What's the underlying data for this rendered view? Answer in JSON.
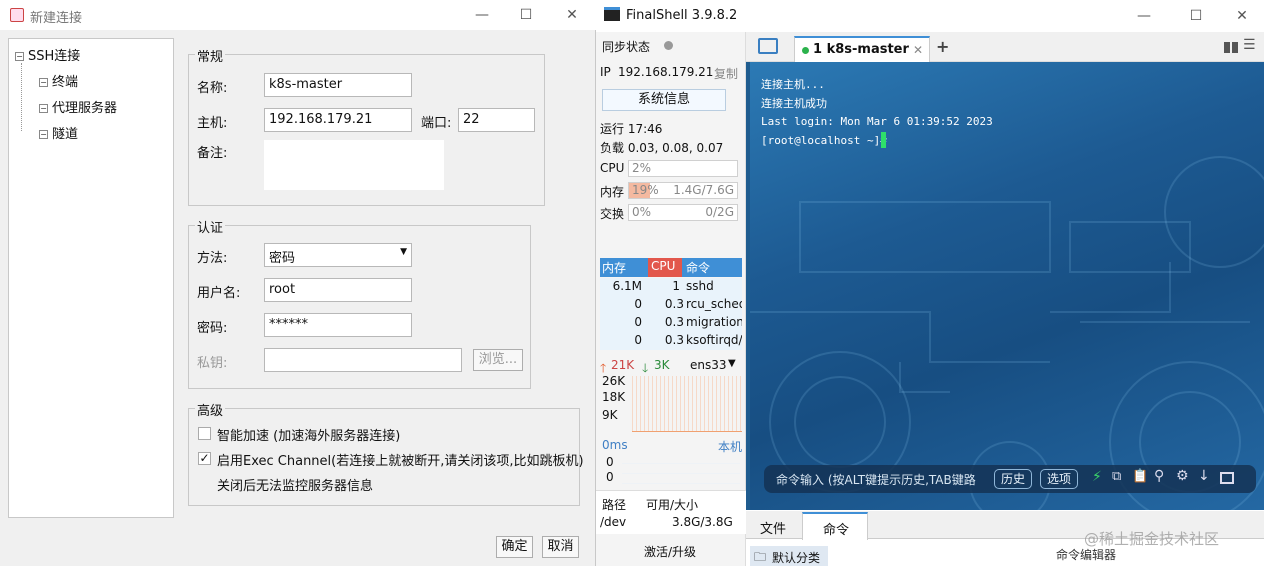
{
  "dialog": {
    "title": "新建连接",
    "tree": {
      "root": "SSH连接",
      "children": [
        "终端",
        "代理服务器",
        "隧道"
      ]
    },
    "general": {
      "group_title": "常规",
      "name_label": "名称:",
      "name_value": "k8s-master",
      "host_label": "主机:",
      "host_value": "192.168.179.21",
      "port_label": "端口:",
      "port_value": "22",
      "note_label": "备注:"
    },
    "auth": {
      "group_title": "认证",
      "method_label": "方法:",
      "method_value": "密码",
      "user_label": "用户名:",
      "user_value": "root",
      "pass_label": "密码:",
      "pass_value": "******",
      "key_label": "私钥:",
      "browse_label": "浏览..."
    },
    "advanced": {
      "group_title": "高级",
      "accel_label": "智能加速 (加速海外服务器连接)",
      "exec_label": "启用Exec Channel(若连接上就被断开,请关闭该项,比如跳板机)",
      "exec_note": "关闭后无法监控服务器信息",
      "accel_checked": false,
      "exec_checked": true
    },
    "ok_label": "确定",
    "cancel_label": "取消"
  },
  "app": {
    "title": "FinalShell 3.9.8.2",
    "sync_label": "同步状态",
    "ip_label": "IP",
    "ip_value": "192.168.179.21",
    "copy_label": "复制",
    "sysinfo_label": "系统信息",
    "uptime": "运行 17:46",
    "load": "负载 0.03, 0.08, 0.07",
    "cpu_label": "CPU",
    "cpu_value": "2%",
    "mem_label": "内存",
    "mem_pct": "19%",
    "mem_usage": "1.4G/7.6G",
    "mem_fraction": 0.19,
    "swap_label": "交换",
    "swap_pct": "0%",
    "swap_usage": "0/2G",
    "proc_headers": [
      "内存",
      "CPU",
      "命令"
    ],
    "processes": [
      {
        "mem": "6.1M",
        "cpu": "1",
        "cmd": "sshd"
      },
      {
        "mem": "0",
        "cpu": "0.3",
        "cmd": "rcu_sched"
      },
      {
        "mem": "0",
        "cpu": "0.3",
        "cmd": "migration/"
      },
      {
        "mem": "0",
        "cpu": "0.3",
        "cmd": "ksoftirqd/"
      }
    ],
    "net_up": "21K",
    "net_down": "3K",
    "net_iface": "ens33",
    "net_ticks": [
      "26K",
      "18K",
      "9K"
    ],
    "ping_label": "0ms",
    "ping_host": "本机",
    "ping_ticks": [
      "0",
      "0",
      "0"
    ],
    "disk_headers": [
      "路径",
      "可用/大小"
    ],
    "disk_path": "/dev",
    "disk_usage": "3.8G/3.8G",
    "upgrade_label": "激活/升级",
    "tab_label": "1 k8s-master",
    "terminal_lines": [
      "连接主机...",
      "连接主机成功",
      "Last login: Mon Mar  6 01:39:52 2023",
      "[root@localhost ~]# "
    ],
    "cmd_placeholder": "命令输入 (按ALT键提示历史,TAB键路",
    "history_label": "历史",
    "options_label": "选项",
    "bottom_tabs": [
      "文件",
      "命令"
    ],
    "default_category": "默认分类",
    "cmd_editor": "命令编辑器",
    "watermark": "@稀土掘金技术社区",
    "accent": "#3f8fd6"
  }
}
